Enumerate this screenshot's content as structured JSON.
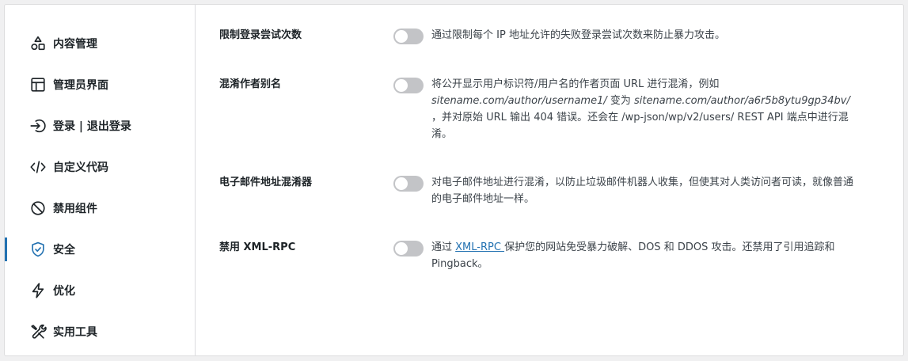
{
  "sidebar": {
    "items": [
      {
        "label": "内容管理",
        "icon": "shapes-icon"
      },
      {
        "label": "管理员界面",
        "icon": "layout-icon"
      },
      {
        "label": "登录 | 退出登录",
        "icon": "login-icon"
      },
      {
        "label": "自定义代码",
        "icon": "code-icon"
      },
      {
        "label": "禁用组件",
        "icon": "ban-icon"
      },
      {
        "label": "安全",
        "icon": "shield-check-icon",
        "active": true
      },
      {
        "label": "优化",
        "icon": "lightning-icon"
      },
      {
        "label": "实用工具",
        "icon": "tools-icon"
      }
    ]
  },
  "settings": {
    "limit_login": {
      "label": "限制登录尝试次数",
      "enabled": false,
      "description": "通过限制每个 IP 地址允许的失败登录尝试次数来防止暴力攻击。"
    },
    "obfuscate_author": {
      "label": "混淆作者别名",
      "enabled": false,
      "desc_part1": "将公开显示用户标识符/用户名的作者页面 URL 进行混淆，例如",
      "desc_example1": "sitename.com/author/username1/",
      "desc_part2": " 变为 ",
      "desc_example2": "sitename.com/author/a6r5b8ytu9gp34bv/",
      "desc_part3": " ，并对原始 URL 输出 404 错误。还会在 /wp-json/wp/v2/users/ REST API 端点中进行混淆。"
    },
    "email_obfuscator": {
      "label": "电子邮件地址混淆器",
      "enabled": false,
      "description": "对电子邮件地址进行混淆，以防止垃圾邮件机器人收集，但使其对人类访问者可读，就像普通的电子邮件地址一样。"
    },
    "disable_xmlrpc": {
      "label": "禁用 XML-RPC",
      "enabled": false,
      "desc_part1": "通过 ",
      "desc_link": "XML-RPC ",
      "desc_part2": "保护您的网站免受暴力破解、DOS 和 DDOS 攻击。还禁用了引用追踪和 Pingback。"
    }
  },
  "colors": {
    "accent": "#2271b1",
    "toggle_off": "#c3c4c7"
  }
}
